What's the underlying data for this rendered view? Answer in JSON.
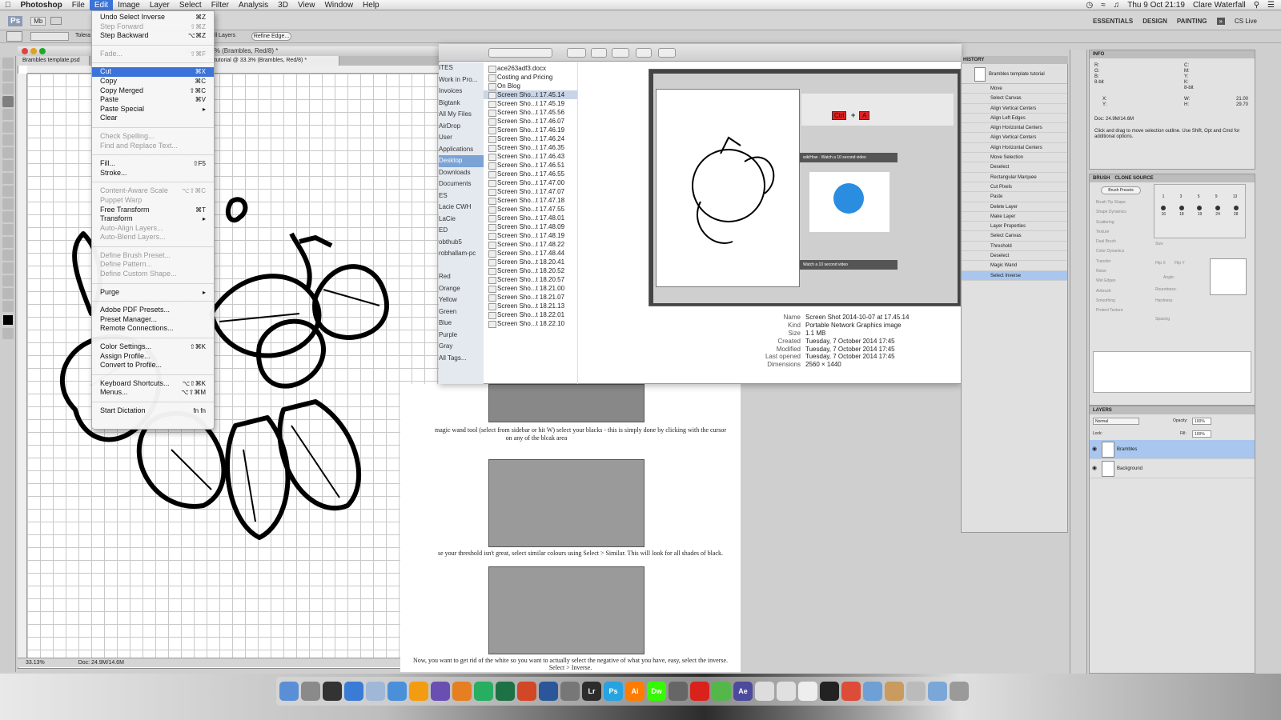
{
  "menubar": {
    "app": "Photoshop",
    "items": [
      "File",
      "Edit",
      "Image",
      "Layer",
      "Select",
      "Filter",
      "Analysis",
      "3D",
      "View",
      "Window",
      "Help"
    ],
    "active": "Edit",
    "datetime": "Thu 9 Oct  21:19",
    "user": "Clare Waterfall"
  },
  "appbar": {
    "ps_logo": "Ps",
    "mode_label": "Mb",
    "workspaces": [
      "ESSENTIALS",
      "DESIGN",
      "PAINTING"
    ],
    "cs_live": "CS Live"
  },
  "options": {
    "refine_edge": "Refine Edge...",
    "tolerance": "Tolera",
    "all_layers": "ll Layers"
  },
  "document": {
    "title": "ial @ 33.3% (Brambles, Red/8) *",
    "tab1": "Brambles template.psd",
    "tab2": "te tutorial @ 33.3% (Brambles, Red/8) *",
    "zoom": "33.13%",
    "doc_size": "Doc: 24.9M/14.6M"
  },
  "edit_menu": [
    {
      "label": "Undo Select Inverse",
      "shortcut": "⌘Z",
      "state": "enabled"
    },
    {
      "label": "Step Forward",
      "shortcut": "⇧⌘Z",
      "state": "disabled"
    },
    {
      "label": "Step Backward",
      "shortcut": "⌥⌘Z",
      "state": "enabled"
    },
    {
      "sep": true
    },
    {
      "label": "Fade...",
      "shortcut": "⇧⌘F",
      "state": "disabled"
    },
    {
      "sep": true
    },
    {
      "label": "Cut",
      "shortcut": "⌘X",
      "state": "highlighted"
    },
    {
      "label": "Copy",
      "shortcut": "⌘C",
      "state": "enabled"
    },
    {
      "label": "Copy Merged",
      "shortcut": "⇧⌘C",
      "state": "enabled"
    },
    {
      "label": "Paste",
      "shortcut": "⌘V",
      "state": "enabled"
    },
    {
      "label": "Paste Special",
      "shortcut": "▸",
      "state": "enabled"
    },
    {
      "label": "Clear",
      "shortcut": "",
      "state": "enabled"
    },
    {
      "sep": true
    },
    {
      "label": "Check Spelling...",
      "shortcut": "",
      "state": "disabled"
    },
    {
      "label": "Find and Replace Text...",
      "shortcut": "",
      "state": "disabled"
    },
    {
      "sep": true
    },
    {
      "label": "Fill...",
      "shortcut": "⇧F5",
      "state": "enabled"
    },
    {
      "label": "Stroke...",
      "shortcut": "",
      "state": "enabled"
    },
    {
      "sep": true
    },
    {
      "label": "Content-Aware Scale",
      "shortcut": "⌥⇧⌘C",
      "state": "disabled"
    },
    {
      "label": "Puppet Warp",
      "shortcut": "",
      "state": "disabled"
    },
    {
      "label": "Free Transform",
      "shortcut": "⌘T",
      "state": "enabled"
    },
    {
      "label": "Transform",
      "shortcut": "▸",
      "state": "enabled"
    },
    {
      "label": "Auto-Align Layers...",
      "shortcut": "",
      "state": "disabled"
    },
    {
      "label": "Auto-Blend Layers...",
      "shortcut": "",
      "state": "disabled"
    },
    {
      "sep": true
    },
    {
      "label": "Define Brush Preset...",
      "shortcut": "",
      "state": "disabled"
    },
    {
      "label": "Define Pattern...",
      "shortcut": "",
      "state": "disabled"
    },
    {
      "label": "Define Custom Shape...",
      "shortcut": "",
      "state": "disabled"
    },
    {
      "sep": true
    },
    {
      "label": "Purge",
      "shortcut": "▸",
      "state": "enabled"
    },
    {
      "sep": true
    },
    {
      "label": "Adobe PDF Presets...",
      "shortcut": "",
      "state": "enabled"
    },
    {
      "label": "Preset Manager...",
      "shortcut": "",
      "state": "enabled"
    },
    {
      "label": "Remote Connections...",
      "shortcut": "",
      "state": "enabled"
    },
    {
      "sep": true
    },
    {
      "label": "Color Settings...",
      "shortcut": "⇧⌘K",
      "state": "enabled"
    },
    {
      "label": "Assign Profile...",
      "shortcut": "",
      "state": "enabled"
    },
    {
      "label": "Convert to Profile...",
      "shortcut": "",
      "state": "enabled"
    },
    {
      "sep": true
    },
    {
      "label": "Keyboard Shortcuts...",
      "shortcut": "⌥⇧⌘K",
      "state": "enabled"
    },
    {
      "label": "Menus...",
      "shortcut": "⌥⇧⌘M",
      "state": "enabled"
    },
    {
      "sep": true
    },
    {
      "label": "Start Dictation",
      "shortcut": "fn fn",
      "state": "enabled"
    }
  ],
  "finder": {
    "sidebar": [
      "ITES",
      "Work in Pro...",
      "Invoices",
      "Bigtank",
      "All My Files",
      "AirDrop",
      "User",
      "Applications",
      "Desktop",
      "Downloads",
      "Documents",
      "ES",
      "Lacie CWH",
      "LaCie",
      "ED",
      "obthub5",
      "robhallam-pc",
      "",
      "Red",
      "Orange",
      "Yellow",
      "Green",
      "Blue",
      "Purple",
      "Gray",
      "All Tags..."
    ],
    "sidebar_selected": "Desktop",
    "files": [
      "ace263adf3.docx",
      "Costing and Pricing",
      "On Blog",
      "Screen Sho...t 17.45.14",
      "Screen Sho...t 17.45.19",
      "Screen Sho...t 17.45.56",
      "Screen Sho...t 17.46.07",
      "Screen Sho...t 17.46.19",
      "Screen Sho...t 17.46.24",
      "Screen Sho...t 17.46.35",
      "Screen Sho...t 17.46.43",
      "Screen Sho...t 17.46.51",
      "Screen Sho...t 17.46.55",
      "Screen Sho...t 17.47.00",
      "Screen Sho...t 17.47.07",
      "Screen Sho...t 17.47.18",
      "Screen Sho...t 17.47.55",
      "Screen Sho...t 17.48.01",
      "Screen Sho...t 17.48.09",
      "Screen Sho...t 17.48.19",
      "Screen Sho...t 17.48.22",
      "Screen Sho...t 17.48.44",
      "Screen Sho...t 18.20.41",
      "Screen Sho...t 18.20.52",
      "Screen Sho...t 18.20.57",
      "Screen Sho...t 18.21.00",
      "Screen Sho...t 18.21.07",
      "Screen Sho...t 18.21.13",
      "Screen Sho...t 18.22.01",
      "Screen Sho...t 18.22.10"
    ],
    "file_selected": "Screen Sho...t 17.45.14",
    "preview_text": {
      "ctrl": "Ctrl",
      "plus": "+",
      "a": "A",
      "video1": "Watch a 10 second video",
      "video2": "Watch a 10 second video",
      "wiki": "wikiHow"
    },
    "info": [
      {
        "k": "Name",
        "v": "Screen Shot 2014-10-07 at 17.45.14"
      },
      {
        "k": "Kind",
        "v": "Portable Network Graphics image"
      },
      {
        "k": "Size",
        "v": "1.1 MB"
      },
      {
        "k": "Created",
        "v": "Tuesday, 7 October 2014 17:45"
      },
      {
        "k": "Modified",
        "v": "Tuesday, 7 October 2014 17:45"
      },
      {
        "k": "Last opened",
        "v": "Tuesday, 7 October 2014 17:45"
      },
      {
        "k": "Dimensions",
        "v": "2560 × 1440"
      }
    ]
  },
  "webpage": {
    "text1": "magic wand tool (select from sidebar or hit W) select your blacks - this is simply done by clicking with the cursor",
    "text1b": "on any of the blcak area",
    "text2": "se your threshold isn't great, select similar colours using Select > Similar. This will look for all shades of black.",
    "text3": "Now, you want to get rid of the white so you want to actually select the negative of what you have, easy, select the inverse.",
    "text3b": "Select > Inverse."
  },
  "history": {
    "title": "HISTORY",
    "snapshot": "Brambles template tutorial",
    "items": [
      "Move",
      "Select Canvas",
      "Align Vertical Centers",
      "Align Left Edges",
      "Align Horizontal Centers",
      "Align Vertical Centers",
      "Align Horizontal Centers",
      "Move Selection",
      "Deselect",
      "Rectangular Marquee",
      "Cut Pixels",
      "Paste",
      "Delete Layer",
      "Make Layer",
      "Layer Properties",
      "Select Canvas",
      "Threshold",
      "Deselect",
      "Magic Wand",
      "Select Inverse"
    ],
    "selected": "Select Inverse"
  },
  "info_panel": {
    "title": "INFO",
    "r": "R:",
    "g": "G:",
    "b": "B:",
    "bit1": "8-bit",
    "c": "C:",
    "m": "M:",
    "y": "Y:",
    "k": "K:",
    "bit2": "8-bit",
    "x": "X:",
    "yc": "Y:",
    "w": "W:",
    "h": "H:",
    "w_val": "21.00",
    "h_val": "29.70",
    "doc": "Doc: 24.9M/14.6M",
    "hint": "Click and drag to move selection outline.  Use Shift, Opt and Cmd for additional options."
  },
  "brush_panel": {
    "tab1": "BRUSH",
    "tab2": "CLONE SOURCE",
    "presets_btn": "Brush Presets",
    "options": [
      "Brush Tip Shape",
      "Shape Dynamics",
      "Scattering",
      "Texture",
      "Dual Brush",
      "Color Dynamics",
      "Transfer",
      "Noise",
      "Wet Edges",
      "Airbrush",
      "Smoothing",
      "Protect Texture"
    ],
    "sizes_row1": [
      "1",
      "3",
      "5",
      "9",
      "13"
    ],
    "sizes_row2": [
      "16",
      "18",
      "19",
      "24",
      "28"
    ],
    "labels": {
      "size": "Size",
      "flipx": "Flip X",
      "flipy": "Flip Y",
      "angle": "Angle:",
      "roundness": "Roundness:",
      "hardness": "Hardness",
      "spacing": "Spacing"
    }
  },
  "layers_panel": {
    "title": "LAYERS",
    "blend": "Normal",
    "opacity_label": "Opacity:",
    "opacity": "100%",
    "lock_label": "Lock:",
    "fill_label": "Fill:",
    "fill": "100%",
    "layers": [
      {
        "name": "Brambles",
        "selected": true
      },
      {
        "name": "Background",
        "selected": false
      }
    ]
  },
  "dock": [
    "Finder",
    "Preview",
    "Dashboard",
    "Safari",
    "Mail",
    "iTunes",
    "VLC",
    "iMovie",
    "Pages",
    "Numbers",
    "Excel",
    "PowerPoint",
    "Word",
    "Utilities",
    "Lr",
    "Ps",
    "Ai",
    "Dw",
    "System Prefs",
    "Acrobat",
    "Evernote",
    "Ae",
    "TextEdit",
    "Photos",
    "Calendar",
    "Terminal",
    "Chrome",
    "Folder",
    "Home",
    "Docs",
    "Downloads",
    "Trash"
  ]
}
